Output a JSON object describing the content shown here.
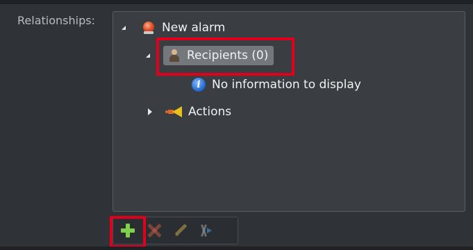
{
  "panel": {
    "label": "Relationships:"
  },
  "tree": {
    "root": {
      "label": "New alarm",
      "icon": "alarm-icon",
      "expanded": true
    },
    "recipients": {
      "label": "Recipients (0)",
      "icon": "person-icon",
      "expanded": true,
      "selected": true
    },
    "empty_message": {
      "label": "No information to display",
      "icon": "info-icon"
    },
    "actions": {
      "label": "Actions",
      "icon": "actions-icon",
      "expanded": false
    }
  },
  "toolbar": {
    "buttons": [
      {
        "name": "add",
        "icon": "plus-icon",
        "enabled": true
      },
      {
        "name": "delete",
        "icon": "delete-icon",
        "enabled": false
      },
      {
        "name": "edit",
        "icon": "edit-icon",
        "enabled": false
      },
      {
        "name": "unlink",
        "icon": "unlink-icon",
        "enabled": false
      }
    ]
  },
  "colors": {
    "background": "#2f3236",
    "panel": "#3a3d41",
    "highlight": "#e0001b",
    "selection": "#74787d",
    "text": "#f0f2f4",
    "label": "#b8bdc2",
    "add": "#7fd14a"
  }
}
